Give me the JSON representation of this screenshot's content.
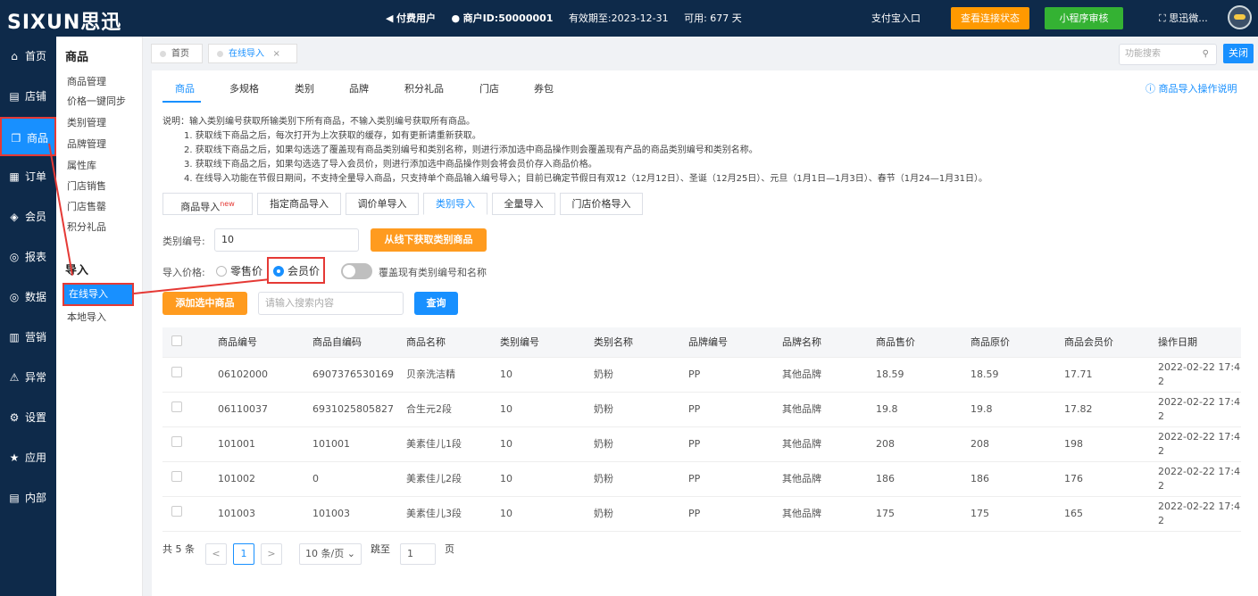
{
  "topbar": {
    "logo": "SIXUN思迅",
    "paid_user": "付费用户",
    "merchant_id": "商户ID:50000001",
    "expiry": "有效期至:2023-12-31",
    "available": "可用: 677 天",
    "alipay_entry": "支付宝入口",
    "btn_connection": "查看连接状态",
    "btn_miniprogram": "小程序审核",
    "user_name": "思迅微..."
  },
  "sidebar": {
    "items": [
      {
        "icon": "home-icon",
        "glyph": "⌂",
        "label": "首页"
      },
      {
        "icon": "store-icon",
        "glyph": "▤",
        "label": "店铺"
      },
      {
        "icon": "gift-icon",
        "glyph": "❒",
        "label": "商品"
      },
      {
        "icon": "order-icon",
        "glyph": "▦",
        "label": "订单"
      },
      {
        "icon": "member-icon",
        "glyph": "◈",
        "label": "会员"
      },
      {
        "icon": "report-icon",
        "glyph": "◎",
        "label": "报表"
      },
      {
        "icon": "data-icon",
        "glyph": "◎",
        "label": "数据"
      },
      {
        "icon": "marketing-icon",
        "glyph": "▥",
        "label": "营销"
      },
      {
        "icon": "warning-icon",
        "glyph": "⚠",
        "label": "异常"
      },
      {
        "icon": "gear-icon",
        "glyph": "⚙",
        "label": "设置"
      },
      {
        "icon": "star-icon",
        "glyph": "★",
        "label": "应用"
      },
      {
        "icon": "doc-icon",
        "glyph": "▤",
        "label": "内部"
      }
    ]
  },
  "submenu": {
    "title_goods": "商品",
    "goods_items": [
      "商品管理",
      "价格一键同步",
      "类别管理",
      "品牌管理",
      "属性库",
      "门店销售",
      "门店售罄",
      "积分礼品"
    ],
    "title_import": "导入",
    "import_active": "在线导入",
    "import_local": "本地导入"
  },
  "pagetabs": {
    "home": "首页",
    "online_import": "在线导入",
    "close_x": "×",
    "func_search_placeholder": "功能搜索",
    "close": "关闭"
  },
  "main": {
    "tabs": [
      "商品",
      "多规格",
      "类别",
      "品牌",
      "积分礼品",
      "门店",
      "券包"
    ],
    "help": "商品导入操作说明",
    "desc": [
      "说明：输入类别编号获取所输类别下所有商品，不输入类别编号获取所有商品。",
      "1. 获取线下商品之后，每次打开为上次获取的缓存，如有更新请重新获取。",
      "2. 获取线下商品之后，如果勾选选了覆盖现有商品类别编号和类别名称，则进行添加选中商品操作则会覆盖现有产品的商品类别编号和类别名称。",
      "3. 获取线下商品之后，如果勾选选了导入会员价，则进行添加选中商品操作则会将会员价存入商品价格。",
      "4. 在线导入功能在节假日期间，不支持全量导入商品，只支持单个商品输入编号导入；目前已确定节假日有双12（12月12日）、圣诞（12月25日）、元旦（1月1日—1月3日）、春节（1月24—1月31日）。"
    ],
    "subtabs": [
      "商品导入",
      "指定商品导入",
      "调价单导入",
      "类别导入",
      "全量导入",
      "门店价格导入"
    ],
    "new_badge": "new",
    "category_label": "类别编号:",
    "category_value": "10",
    "btn_fetch": "从线下获取类别商品",
    "price_label": "导入价格:",
    "radio_retail": "零售价",
    "radio_member": "会员价",
    "toggle_label": "覆盖现有类别编号和名称",
    "btn_add": "添加选中商品",
    "search_placeholder": "请输入搜索内容",
    "btn_query": "查询"
  },
  "table": {
    "headers": [
      "商品编号",
      "商品自编码",
      "商品名称",
      "类别编号",
      "类别名称",
      "品牌编号",
      "品牌名称",
      "商品售价",
      "商品原价",
      "商品会员价",
      "操作日期"
    ],
    "rows": [
      [
        "06102000",
        "6907376530169",
        "贝亲洗洁精",
        "10",
        "奶粉",
        "PP",
        "其他品牌",
        "18.59",
        "18.59",
        "17.71",
        "2022-02-22 17:42"
      ],
      [
        "06110037",
        "6931025805827",
        "合生元2段",
        "10",
        "奶粉",
        "PP",
        "其他品牌",
        "19.8",
        "19.8",
        "17.82",
        "2022-02-22 17:42"
      ],
      [
        "101001",
        "101001",
        "美素佳儿1段",
        "10",
        "奶粉",
        "PP",
        "其他品牌",
        "208",
        "208",
        "198",
        "2022-02-22 17:42"
      ],
      [
        "101002",
        "0",
        "美素佳儿2段",
        "10",
        "奶粉",
        "PP",
        "其他品牌",
        "186",
        "186",
        "176",
        "2022-02-22 17:42"
      ],
      [
        "101003",
        "101003",
        "美素佳儿3段",
        "10",
        "奶粉",
        "PP",
        "其他品牌",
        "175",
        "175",
        "165",
        "2022-02-22 17:42"
      ]
    ]
  },
  "pagination": {
    "total": "共 5 条",
    "prev": "<",
    "page": "1",
    "next": ">",
    "page_size": "10 条/页",
    "goto": "跳至",
    "goto_value": "1",
    "page_unit": "页"
  },
  "colors": {
    "nav_bg": "#0e2a4a",
    "accent": "#1890ff",
    "orange": "#ff9b1f",
    "green": "#34b233",
    "highlight": "#e53935"
  }
}
